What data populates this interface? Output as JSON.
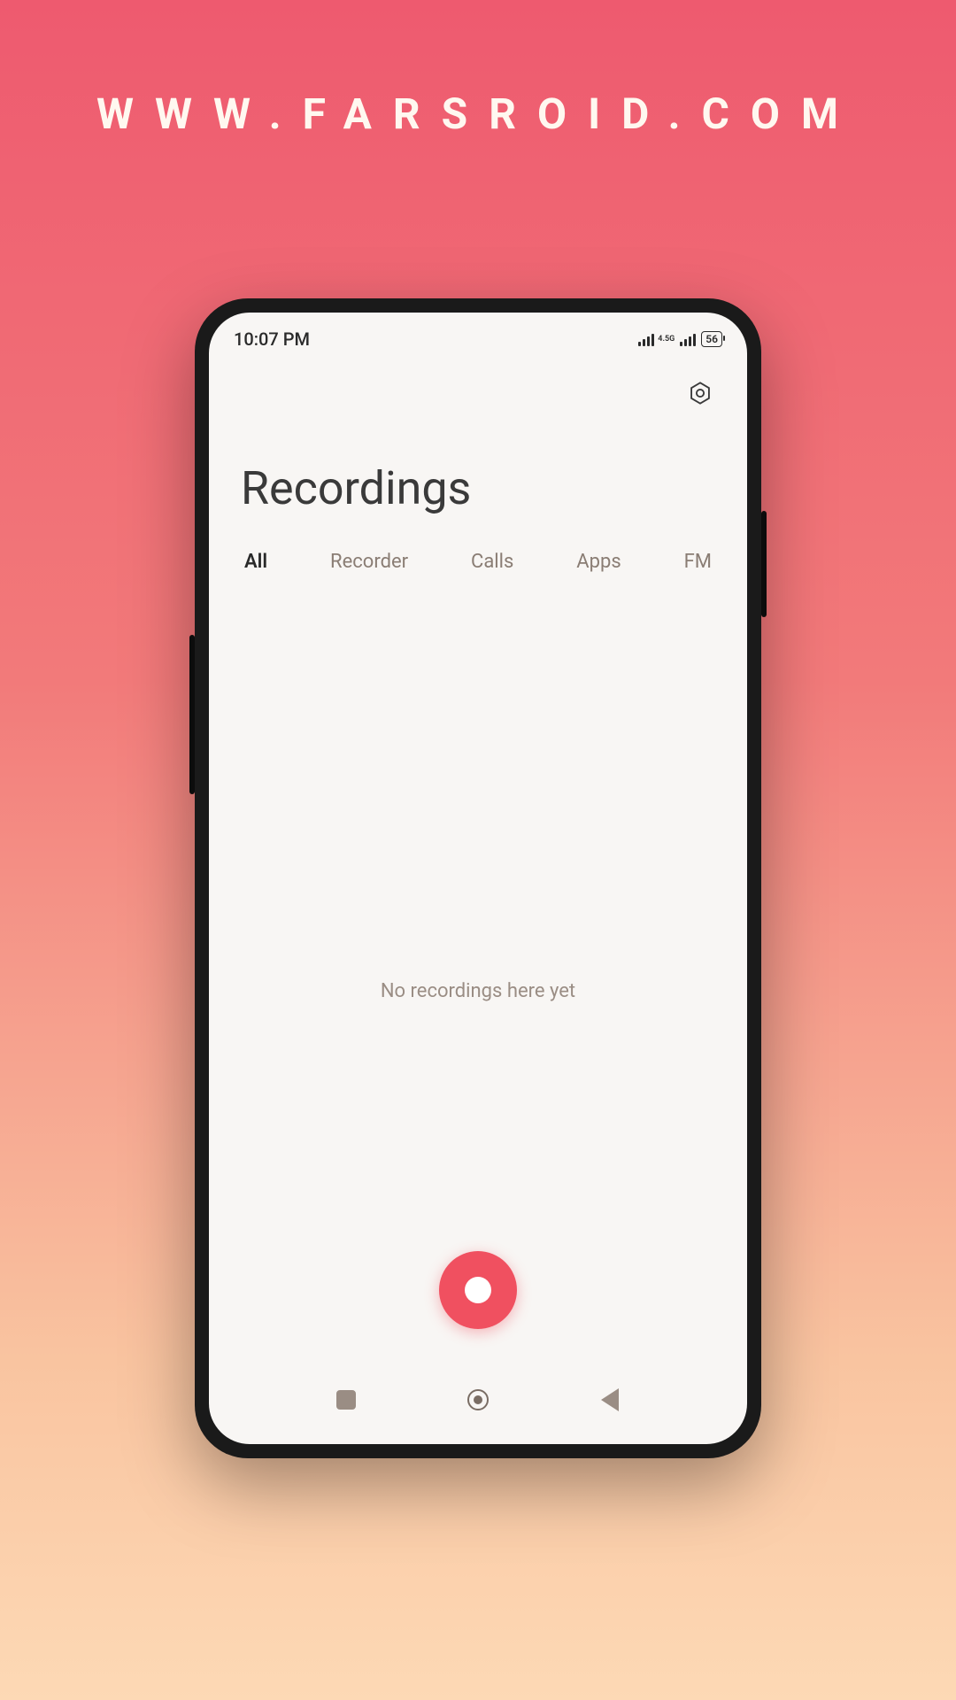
{
  "watermark": "WWW.FARSROID.COM",
  "status_bar": {
    "time": "10:07 PM",
    "network_type": "4.5G",
    "battery_level": "56"
  },
  "app": {
    "title": "Recordings",
    "tabs": [
      {
        "label": "All",
        "active": true
      },
      {
        "label": "Recorder",
        "active": false
      },
      {
        "label": "Calls",
        "active": false
      },
      {
        "label": "Apps",
        "active": false
      },
      {
        "label": "FM",
        "active": false
      }
    ],
    "empty_message": "No recordings here yet"
  },
  "colors": {
    "accent": "#f05060"
  }
}
